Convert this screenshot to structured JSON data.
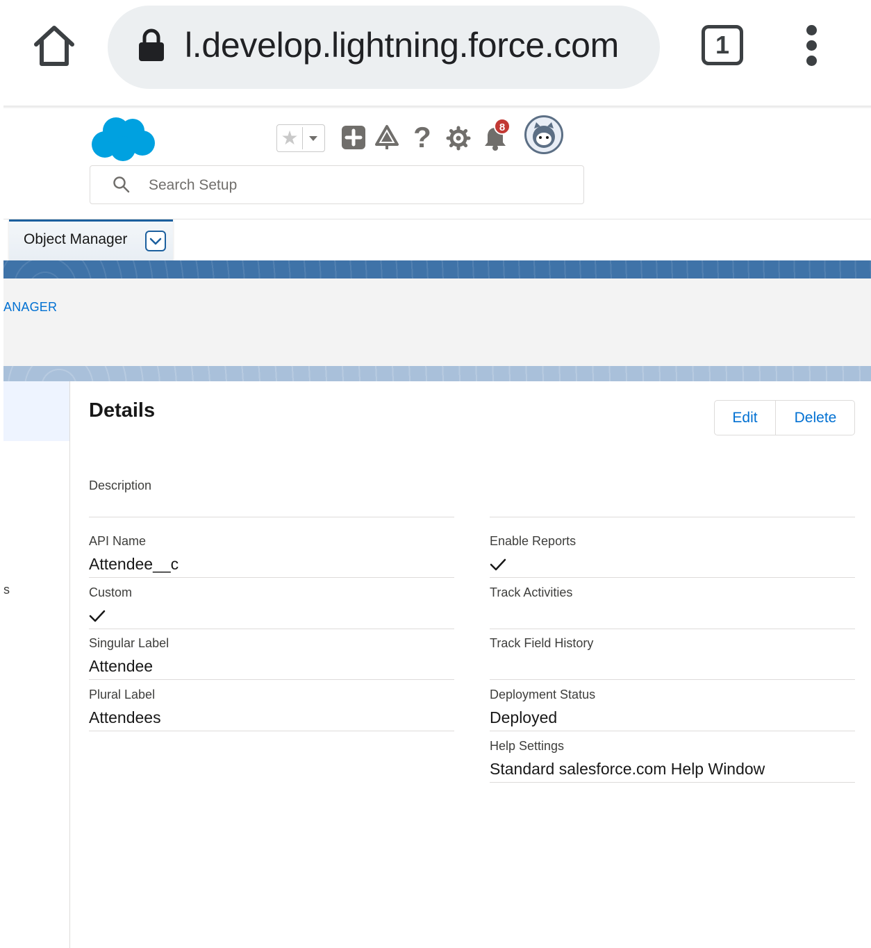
{
  "browser": {
    "url": "l.develop.lightning.force.com",
    "tab_count": "1"
  },
  "header": {
    "search_placeholder": "Search Setup",
    "notification_count": "8"
  },
  "nav": {
    "object_manager_label": "Object Manager"
  },
  "breadcrumb": "ANAGER",
  "left_rail": {
    "partial_item": "s"
  },
  "details": {
    "title": "Details",
    "edit_label": "Edit",
    "delete_label": "Delete",
    "description_label": "Description",
    "api_name_label": "API Name",
    "api_name_value": "Attendee__c",
    "custom_label": "Custom",
    "custom_checked": true,
    "singular_label_label": "Singular Label",
    "singular_label_value": "Attendee",
    "plural_label_label": "Plural Label",
    "plural_label_value": "Attendees",
    "enable_reports_label": "Enable Reports",
    "enable_reports_checked": true,
    "track_activities_label": "Track Activities",
    "track_field_history_label": "Track Field History",
    "deployment_status_label": "Deployment Status",
    "deployment_status_value": "Deployed",
    "help_settings_label": "Help Settings",
    "help_settings_value": "Standard salesforce.com Help Window"
  },
  "colors": {
    "brand_blue": "#00a1e0",
    "link_blue": "#0070d2",
    "banner_blue": "#3f73a8",
    "badge_red": "#c23934"
  }
}
